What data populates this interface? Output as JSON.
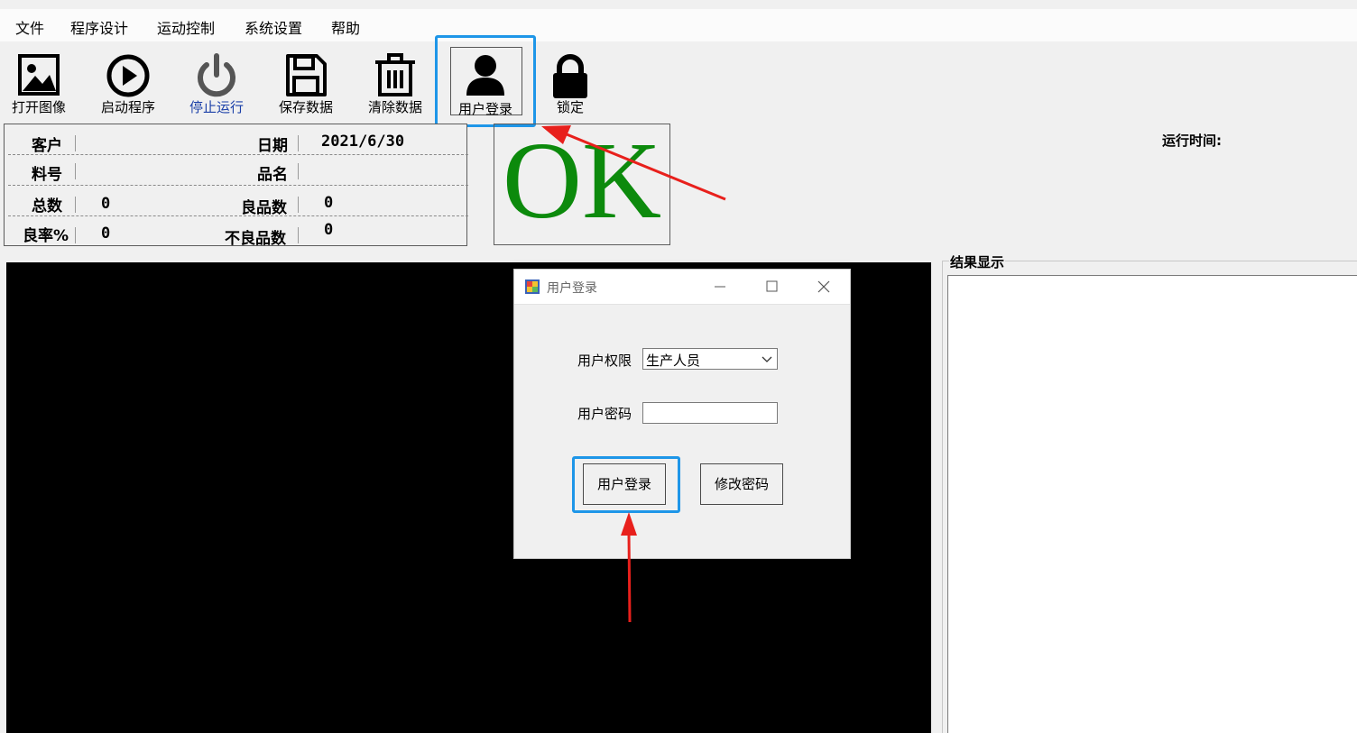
{
  "menu": {
    "items": [
      "文件",
      "程序设计",
      "运动控制",
      "系统设置",
      "帮助"
    ]
  },
  "toolbar": {
    "buttons": [
      {
        "label": "打开图像",
        "icon": "image-icon"
      },
      {
        "label": "启动程序",
        "icon": "play-icon"
      },
      {
        "label": "停止运行",
        "icon": "power-icon"
      },
      {
        "label": "保存数据",
        "icon": "save-icon"
      },
      {
        "label": "清除数据",
        "icon": "trash-icon"
      },
      {
        "label": "用户登录",
        "icon": "user-icon"
      },
      {
        "label": "锁定",
        "icon": "lock-icon"
      }
    ],
    "stop_label_color": "#1a3fa8",
    "highlight_color": "#1e96e8"
  },
  "info": {
    "customer_label": "客户",
    "customer_value": "",
    "date_label": "日期",
    "date_value": "2021/6/30",
    "part_label": "料号",
    "part_value": "",
    "product_label": "品名",
    "product_value": "",
    "total_label": "总数",
    "total_value": "0",
    "good_label": "良品数",
    "good_value": "0",
    "rate_label": "良率%",
    "rate_value": "0",
    "bad_label": "不良品数",
    "bad_value": "0"
  },
  "status": {
    "ok_text": "OK",
    "ok_color": "#0c8a0c"
  },
  "runtime": {
    "label": "运行时间:"
  },
  "results": {
    "legend": "结果显示"
  },
  "dialog": {
    "title": "用户登录",
    "role_label": "用户权限",
    "role_value": "生产人员",
    "password_label": "用户密码",
    "password_value": "",
    "login_button": "用户登录",
    "change_password_button": "修改密码"
  },
  "annotations": {
    "arrow_color": "#e8201c"
  }
}
